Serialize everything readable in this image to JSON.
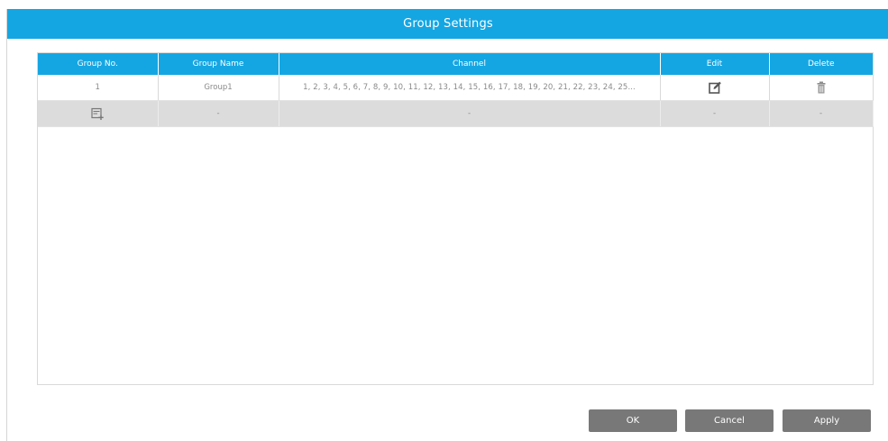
{
  "dialog": {
    "title": "Group Settings"
  },
  "table": {
    "headers": {
      "group_no": "Group No.",
      "group_name": "Group Name",
      "channel": "Channel",
      "edit": "Edit",
      "delete": "Delete"
    },
    "rows": [
      {
        "group_no": "1",
        "group_name": "Group1",
        "channel": "1, 2, 3, 4, 5, 6, 7, 8, 9, 10, 11, 12, 13, 14, 15, 16, 17, 18, 19, 20, 21, 22, 23, 24, 25..."
      }
    ],
    "add_row": {
      "group_name": "-",
      "channel": "-",
      "edit": "-",
      "delete": "-"
    }
  },
  "buttons": {
    "ok": "OK",
    "cancel": "Cancel",
    "apply": "Apply"
  },
  "icons": {
    "edit": "edit-icon",
    "delete": "trash-icon",
    "add": "add-group-icon"
  },
  "colors": {
    "accent": "#14a6e3",
    "button": "#787878",
    "add_row_bg": "#dcdcdc"
  }
}
